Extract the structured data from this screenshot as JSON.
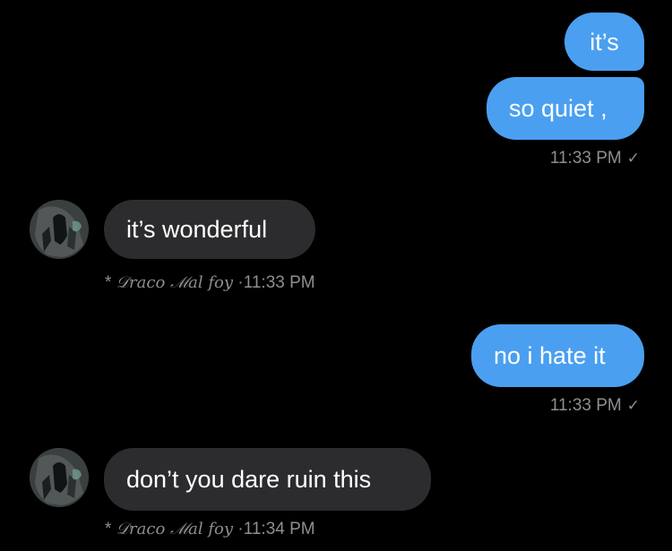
{
  "messages": [
    {
      "id": "m1",
      "direction": "outgoing",
      "text": "it’s"
    },
    {
      "id": "m2",
      "direction": "outgoing",
      "text": "so quiet ,",
      "time": "11:33 PM",
      "status_icon": "check-icon"
    },
    {
      "id": "m3",
      "direction": "incoming",
      "text": "it’s wonderful",
      "sender_prefix": "*",
      "sender": "𝒟raco ℳal foy",
      "separator": "·",
      "time": "11:33 PM",
      "avatar": "avatar-icon"
    },
    {
      "id": "m4",
      "direction": "outgoing",
      "text": "no i hate it",
      "time": "11:33 PM",
      "status_icon": "check-icon"
    },
    {
      "id": "m5",
      "direction": "incoming",
      "text": "don’t you dare ruin this",
      "sender_prefix": "*",
      "sender": "𝒟raco ℳal foy",
      "separator": "·",
      "time": "11:34 PM",
      "avatar": "avatar-icon"
    }
  ],
  "check_glyph": "✓",
  "colors": {
    "background": "#000000",
    "outgoing_bubble": "#4a9ff0",
    "incoming_bubble": "#2c2c2e",
    "meta_text": "#8e8e93"
  }
}
